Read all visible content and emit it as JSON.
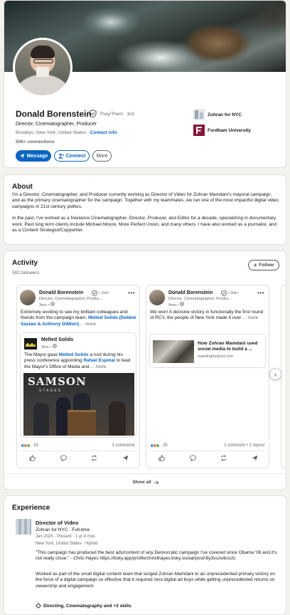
{
  "profile": {
    "name": "Donald Borenstein",
    "pronouns": "They/Them",
    "degree": "· 3rd",
    "headline": "Director, Cinematographer, Producer",
    "location": "Brooklyn, New York, United States",
    "location_sep": " · ",
    "contact_label": "Contact info",
    "connections": "500+ connections",
    "message_label": "Message",
    "connect_label": "Connect",
    "more_label": "More",
    "orgs": [
      {
        "name": "Zohran for NYC",
        "logo_color": "#9aa4b3"
      },
      {
        "name": "Fordham University",
        "logo_color": "#8a1538"
      }
    ]
  },
  "about": {
    "title": "About",
    "p1": "I'm a Director, Cinematographer, and Producer currently working as Director of Video for Zohran Mamdani's mayoral campaign, and as the primary cinematographer for the campaign. Together with my teammates, we ran one of the most impactful digital video campaigns in 21st century politics.",
    "p2": "In the past, I've worked as a freelance Cinematographer, Director, Producer, and Editor for a decade, specializing in documentary work. Past long term clients include Michael Moore, More Perfect Union, and many others. I have also worked as a journalist, and as a Content Strategist/Copywriter."
  },
  "activity": {
    "title": "Activity",
    "followers": "582 followers",
    "follow_label": "Follow",
    "show_all": "Show all",
    "posts": [
      {
        "author": "Donald Borenstein",
        "degree": "• 3rd+",
        "headline": "Director, Cinematographer, Produc...",
        "time": "3mo •",
        "text_a": "Extremely exciting to see my brilliant colleagues and friends from the campaign team, ",
        "text_link": "Melted Solids (Debbie Saslaw & Anthony DiMieri)",
        "text_b": "... more",
        "repost": {
          "name": "Melted Solids",
          "time": "3mo •",
          "text_a": "The Mayor gave ",
          "link1": "Melted Solids",
          "text_b": " a nod during his press conference appointing ",
          "link2": "Rafael Espinal",
          "text_c": " to lead the Mayor's Office of Media and",
          "more": "... more",
          "image_word": "SAMSON",
          "image_sub": "STAGES"
        },
        "reactions": "18",
        "right_stat": "3 comments"
      },
      {
        "author": "Donald Borenstein",
        "degree": "• 3rd+",
        "headline": "Director, Cinematographer, Produc...",
        "time": "9mo •",
        "text_a": "We won! A decisive victory in functionally the first round of RCV, the people of New York made it over",
        "text_b": "... more",
        "article": {
          "title": "How Zohran Mamdani used social media to build a ...",
          "source": "washingtonpost.com"
        },
        "reactions": "25",
        "right_stat": "1 comment • 1 repost"
      }
    ]
  },
  "experience": {
    "title": "Experience",
    "job_title": "Director of Video",
    "company": "Zohran for NYC · Full-time",
    "dates": "Jan 2025 - Present · 1 yr 4 mos",
    "location": "New York, United States · Hybrid",
    "quote_a": "\"This campaign has produced the best ads/content of any Democratic campaign I've covered since Obama '08 and it's not really close.\" - Chris Hayes ",
    "quote_link": "https://bsky.app/profile/chrislhayes.bsky.social/post/3ly3xszwbss2c",
    "desc": "Worked as part of the small digital content team that surged Zohran Mamdani to an unprecedented primary victory on the force of a digital campaign so effective that it required zero digital ad buys while getting unprecedented returns on viewership and engagement.",
    "skills": "Directing, Cinematography and +3 skills"
  },
  "colors": {
    "accent": "#0a66c2",
    "page_bg": "#f4f2ee"
  }
}
